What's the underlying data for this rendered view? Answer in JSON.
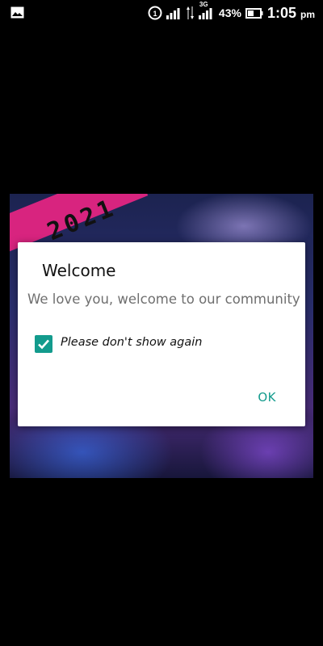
{
  "status_bar": {
    "battery_percent": "43%",
    "time": "1:05",
    "ampm": "pm",
    "network_type": "3G",
    "icons": [
      "image-icon",
      "data-saver-icon",
      "signal-icon",
      "signal-icon",
      "battery-icon"
    ]
  },
  "background": {
    "banner_text": "2021"
  },
  "dialog": {
    "title": "Welcome",
    "message": "We love you, welcome to our community",
    "checkbox_label": "Please don't show again",
    "checkbox_checked": true,
    "ok_label": "OK"
  },
  "colors": {
    "accent": "#139b8d",
    "banner": "#d8247f"
  }
}
